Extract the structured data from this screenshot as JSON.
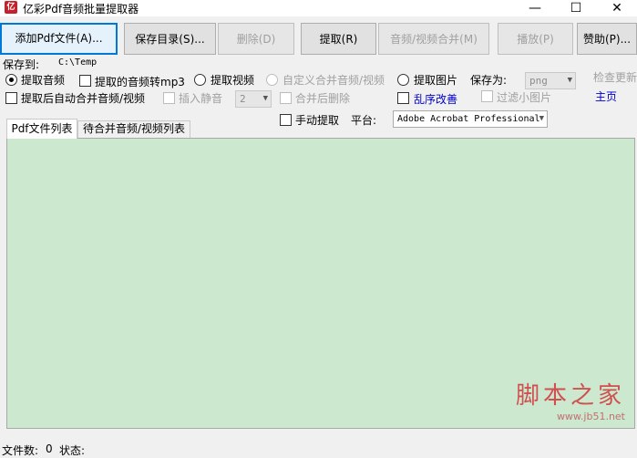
{
  "window": {
    "title": "亿彩Pdf音频批量提取器",
    "icon_text": "亿",
    "minimize": "—",
    "maximize": "☐",
    "close": "✕"
  },
  "toolbar": {
    "add_pdf": "添加Pdf文件(A)...",
    "save_dir": "保存目录(S)...",
    "delete": "删除(D)",
    "extract": "提取(R)",
    "merge": "音频/视频合并(M)",
    "play": "播放(P)",
    "donate": "赞助(P)..."
  },
  "options": {
    "save_to_label": "保存到:",
    "save_to_path": "C:\\Temp",
    "extract_audio": "提取音频",
    "audio_to_mp3": "提取的音频转mp3",
    "extract_video": "提取视频",
    "custom_merge": "自定义合并音频/视频",
    "extract_image": "提取图片",
    "save_as_label": "保存为:",
    "save_as_value": "png",
    "check_update": "检查更新",
    "auto_merge": "提取后自动合并音频/视频",
    "insert_silence": "插入静音",
    "silence_value": "2",
    "delete_after_merge": "合并后删除",
    "shuffle": "乱序改善",
    "filter_small": "过滤小图片",
    "homepage": "主页",
    "manual_extract": "手动提取",
    "platform_label": "平台:",
    "platform_value": "Adobe Acrobat Professional"
  },
  "tabs": {
    "pdf_list": "Pdf文件列表",
    "merge_list": "待合并音频/视频列表"
  },
  "watermark": {
    "main": "脚本之家",
    "sub": "www.jb51.net"
  },
  "status": {
    "file_count_label": "文件数:",
    "file_count": "0",
    "status_label": "状态:",
    "status_value": ""
  },
  "colors": {
    "list_background": "#cce8cf",
    "active_button_border": "#0078d7",
    "link": "#0000cc"
  }
}
